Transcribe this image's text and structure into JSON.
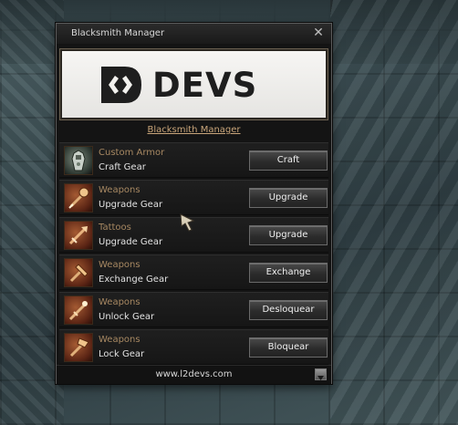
{
  "window": {
    "title": "Blacksmith Manager",
    "close_label": "✕"
  },
  "banner": {
    "logo_text": "DEVS"
  },
  "subtitle": "Blacksmith Manager",
  "rows": [
    {
      "category": "Custom Armor",
      "action": "Craft Gear",
      "button": "Craft",
      "icon": "armor-icon"
    },
    {
      "category": "Weapons",
      "action": "Upgrade Gear",
      "button": "Upgrade",
      "icon": "weapon-icon"
    },
    {
      "category": "Tattoos",
      "action": "Upgrade Gear",
      "button": "Upgrade",
      "icon": "tattoo-icon"
    },
    {
      "category": "Weapons",
      "action": "Exchange Gear",
      "button": "Exchange",
      "icon": "weapon-icon"
    },
    {
      "category": "Weapons",
      "action": "Unlock Gear",
      "button": "Desloquear",
      "icon": "weapon-icon"
    },
    {
      "category": "Weapons",
      "action": "Lock Gear",
      "button": "Bloquear",
      "icon": "weapon-icon"
    }
  ],
  "footer": {
    "text": "www.l2devs.com"
  },
  "colors": {
    "category": "#a78862",
    "link": "#c9a57a",
    "text": "#e2e2e2"
  }
}
